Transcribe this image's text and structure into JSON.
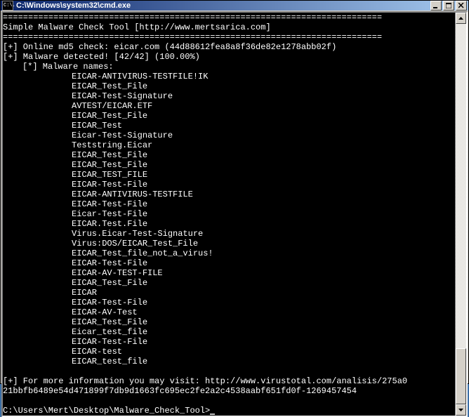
{
  "titlebar": {
    "icon_text": "C:\\.",
    "title": "C:\\Windows\\system32\\cmd.exe"
  },
  "separator": "===========================================================================",
  "header_line": "Simple Malware Check Tool [http://www.mertsarica.com]",
  "md5_line": "[+] Online md5 check: eicar.com (44d88612fea8a8f36de82e1278abb02f)",
  "detected_line": "[+] Malware detected! [42/42] (100.00%)",
  "names_header": "[*] Malware names:",
  "malware_names": [
    "EICAR-ANTIVIRUS-TESTFILE!IK",
    "EICAR_Test_File",
    "EICAR-Test-Signature",
    "AVTEST/EICAR.ETF",
    "EICAR_Test_File",
    "EICAR_Test",
    "Eicar-Test-Signature",
    "Teststring.Eicar",
    "EICAR_Test_File",
    "EICAR_Test_File",
    "EICAR_TEST_FILE",
    "EICAR-Test-File",
    "EICAR-ANTIVIRUS-TESTFILE",
    "EICAR-Test-File",
    "Eicar-Test-File",
    "EICAR.Test.File",
    "Virus.Eicar-Test-Signature",
    "Virus:DOS/EICAR_Test_File",
    "EICAR_Test_file_not_a_virus!",
    "EICAR-Test-File",
    "EICAR-AV-TEST-FILE",
    "EICAR_Test_File",
    "EICAR",
    "EICAR-Test-File",
    "EICAR-AV-Test",
    "EICAR_Test_File",
    "Eicar_test_file",
    "EICAR-Test-File",
    "EICAR-test",
    "EICAR_test_file"
  ],
  "info_line1": "[+] For more information you may visit: http://www.virustotal.com/analisis/275a0",
  "info_line2": "21bbfb6489e54d471899f7db9d1663fc695ec2fe2a2c4538aabf651fd0f-1269457454",
  "prompt": "C:\\Users\\Mert\\Desktop\\Malware_Check_Tool>"
}
